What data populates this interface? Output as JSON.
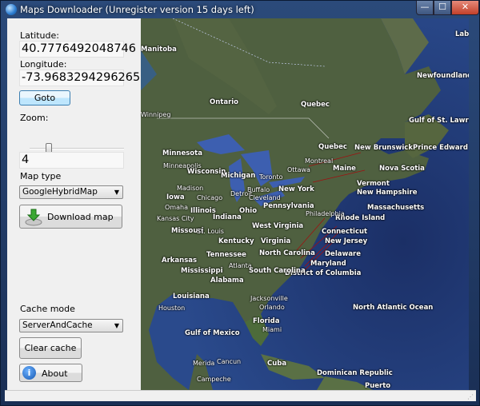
{
  "window": {
    "title": "Maps Downloader (Unregister version 15 days left)",
    "min": "—",
    "max": "☐",
    "close": "✕"
  },
  "panel": {
    "latitude_label": "Latitude:",
    "latitude": "40.7776492048746",
    "longitude_label": "Longitude:",
    "longitude": "-73.9683294296265",
    "goto": "Goto",
    "zoom_label": "Zoom:",
    "zoom_value": "4",
    "zoom_level": 4,
    "map_type_label": "Map type",
    "map_type": "GoogleHybridMap",
    "download": "Download map",
    "cache_mode_label": "Cache mode",
    "cache_mode": "ServerAndCache",
    "clear_cache": "Clear cache",
    "about": "About"
  },
  "map": {
    "labels": [
      "Labrador Sea",
      "Newfoundland and Labrador",
      "Ontario",
      "Quebec",
      "Gulf of St. Lawrence",
      "Winnipeg",
      "Manitoba",
      "Minnesota",
      "Quebec",
      "New Brunswick",
      "Prince Edward Island",
      "Nova Scotia",
      "Maine",
      "Minneapolis",
      "Wisconsin",
      "Michigan",
      "Ottawa",
      "Toronto",
      "Montreal",
      "Vermont",
      "New Hampshire",
      "Buffalo",
      "New York",
      "Iowa",
      "Madison",
      "Chicago",
      "Detroit",
      "Cleveland",
      "Massachusetts",
      "Omaha",
      "Pennsylvania",
      "Rhode Island",
      "Illinois",
      "Indiana",
      "Ohio",
      "Kansas City",
      "Philadelphia",
      "Connecticut",
      "New Jersey",
      "Missouri",
      "St. Louis",
      "West Virginia",
      "Kentucky",
      "Virginia",
      "Delaware",
      "Tennessee",
      "Maryland",
      "Arkansas",
      "North Carolina",
      "Atlanta",
      "District of Columbia",
      "Mississippi",
      "Alabama",
      "South Carolina",
      "Louisiana",
      "Jacksonville",
      "Houston",
      "Orlando",
      "Florida",
      "Miami",
      "Gulf of Mexico",
      "North Atlantic Ocean",
      "Cuba",
      "Merida",
      "Cancun",
      "Campeche",
      "Dominican Republic",
      "Puerto"
    ]
  },
  "colors": {
    "land": "#4d5e3a",
    "ocean": "#1f3a7a",
    "lakes": "#3d5fb0"
  }
}
